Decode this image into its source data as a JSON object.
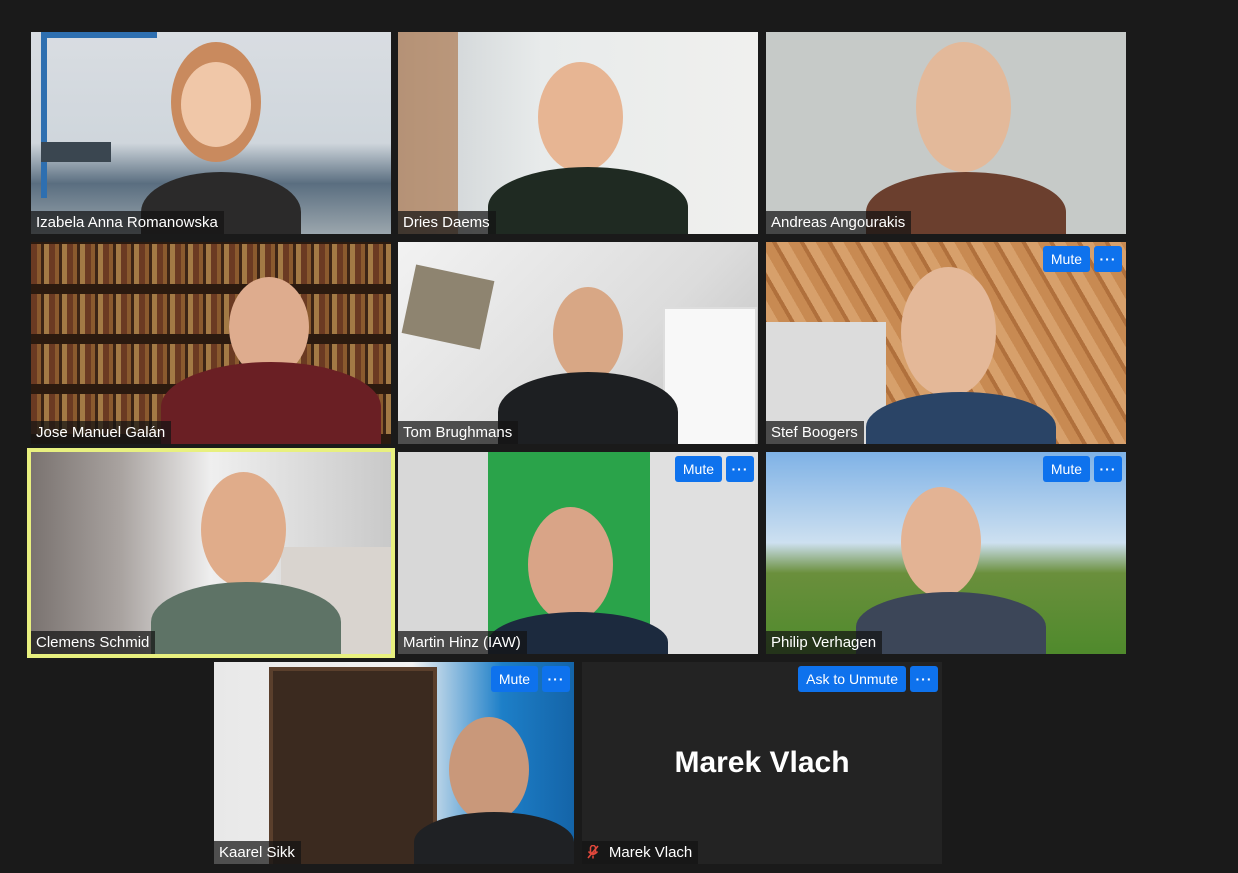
{
  "participants": [
    {
      "name": "Izabela Anna Romanowska"
    },
    {
      "name": "Dries Daems"
    },
    {
      "name": "Andreas Angourakis"
    },
    {
      "name": "Jose Manuel Galán"
    },
    {
      "name": "Tom Brughmans"
    },
    {
      "name": "Stef Boogers",
      "mute_label": "Mute",
      "more_label": "···"
    },
    {
      "name": "Clemens Schmid",
      "active_speaker": true
    },
    {
      "name": "Martin Hinz (IAW)",
      "mute_label": "Mute",
      "more_label": "···"
    },
    {
      "name": "Philip Verhagen",
      "mute_label": "Mute",
      "more_label": "···"
    },
    {
      "name": "Kaarel Sikk",
      "mute_label": "Mute",
      "more_label": "···"
    },
    {
      "name": "Marek Vlach",
      "ask_unmute_label": "Ask to Unmute",
      "more_label": "···",
      "video_off": true,
      "mic_icon": "muted-mic-icon"
    }
  ],
  "colors": {
    "background": "#1a1a1a",
    "button": "#0e72ed",
    "active_border": "#e8f07f",
    "muted_mic": "#e2483c"
  }
}
